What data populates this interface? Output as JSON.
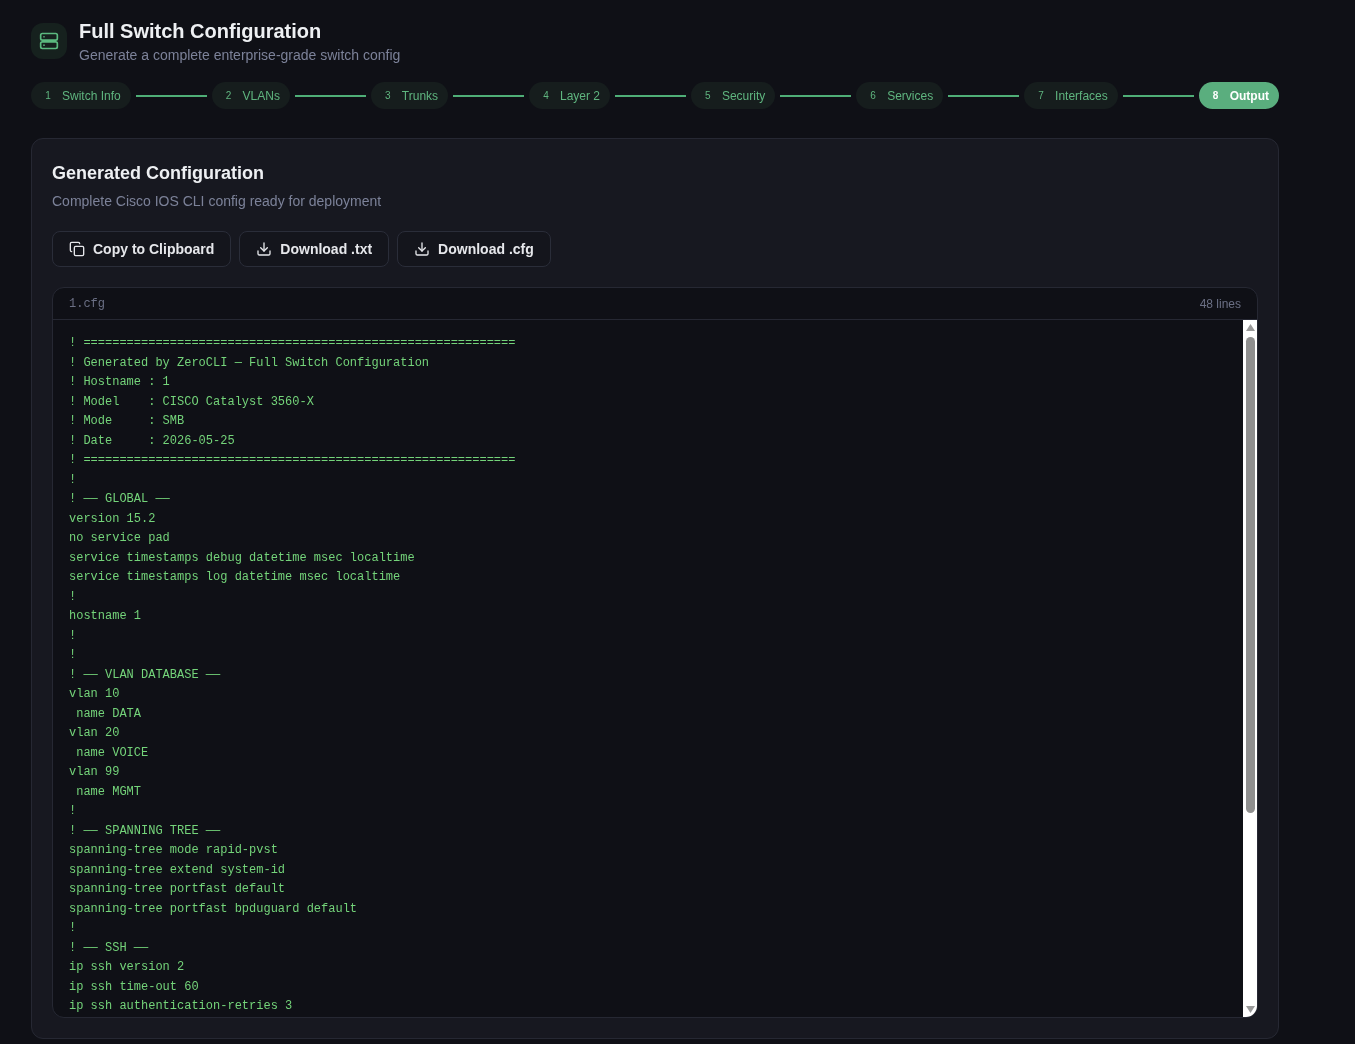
{
  "header": {
    "title": "Full Switch Configuration",
    "subtitle": "Generate a complete enterprise-grade switch config"
  },
  "steps": [
    {
      "number": "1",
      "label": "Switch Info",
      "selected": false
    },
    {
      "number": "2",
      "label": "VLANs",
      "selected": false
    },
    {
      "number": "3",
      "label": "Trunks",
      "selected": false
    },
    {
      "number": "4",
      "label": "Layer 2",
      "selected": false
    },
    {
      "number": "5",
      "label": "Security",
      "selected": false
    },
    {
      "number": "6",
      "label": "Services",
      "selected": false
    },
    {
      "number": "7",
      "label": "Interfaces",
      "selected": false
    },
    {
      "number": "8",
      "label": "Output",
      "selected": true
    }
  ],
  "card": {
    "title": "Generated Configuration",
    "subtitle": "Complete Cisco IOS CLI config ready for deployment",
    "buttons": [
      {
        "kind": "copy",
        "label": "Copy to Clipboard"
      },
      {
        "kind": "download",
        "label": "Download .txt"
      },
      {
        "kind": "download",
        "label": "Download .cfg"
      }
    ],
    "code": {
      "filename": "1.cfg",
      "line_count": "48 lines",
      "lines": [
        "! ============================================================",
        "! Generated by ZeroCLI — Full Switch Configuration",
        "! Hostname : 1",
        "! Model    : CISCO Catalyst 3560-X",
        "! Mode     : SMB",
        "! Date     : 2026-05-25",
        "! ============================================================",
        "!",
        "! ── GLOBAL ──",
        "version 15.2",
        "no service pad",
        "service timestamps debug datetime msec localtime",
        "service timestamps log datetime msec localtime",
        "!",
        "hostname 1",
        "!",
        "!",
        "! ── VLAN DATABASE ──",
        "vlan 10",
        " name DATA",
        "vlan 20",
        " name VOICE",
        "vlan 99",
        " name MGMT",
        "!",
        "! ── SPANNING TREE ──",
        "spanning-tree mode rapid-pvst",
        "spanning-tree extend system-id",
        "spanning-tree portfast default",
        "spanning-tree portfast bpduguard default",
        "!",
        "! ── SSH ──",
        "ip ssh version 2",
        "ip ssh time-out 60",
        "ip ssh authentication-retries 3"
      ]
    }
  }
}
